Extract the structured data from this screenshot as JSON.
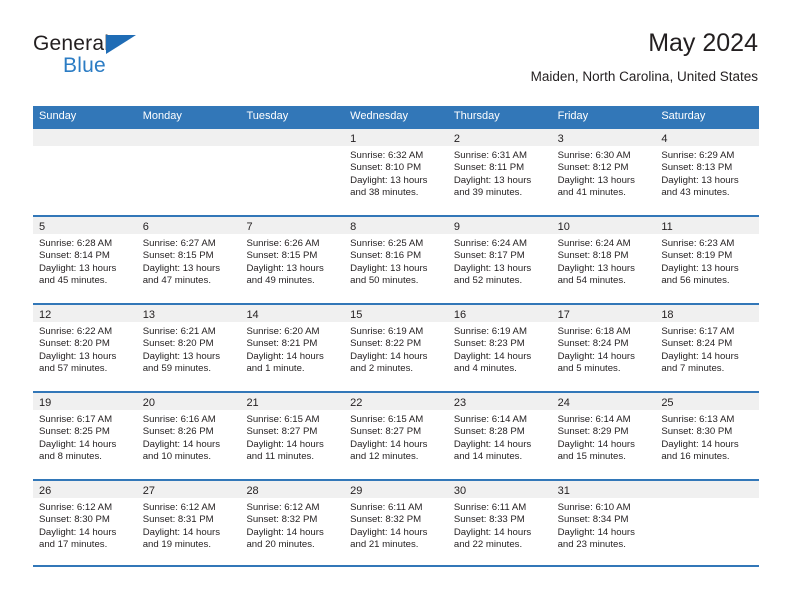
{
  "logo": {
    "word_one": "General",
    "word_two": "Blue",
    "triangle_color": "#1f6cb5",
    "blue_text_color": "#2b7cc4"
  },
  "header": {
    "title": "May 2024",
    "subtitle": "Maiden, North Carolina, United States"
  },
  "theme": {
    "header_blue": "#3277b8",
    "day_band_gray": "#f0f0f0",
    "text_color": "#231f20"
  },
  "weekdays": [
    "Sunday",
    "Monday",
    "Tuesday",
    "Wednesday",
    "Thursday",
    "Friday",
    "Saturday"
  ],
  "weeks": [
    [
      {
        "day": "",
        "lines": []
      },
      {
        "day": "",
        "lines": []
      },
      {
        "day": "",
        "lines": []
      },
      {
        "day": "1",
        "lines": [
          "Sunrise: 6:32 AM",
          "Sunset: 8:10 PM",
          "Daylight: 13 hours",
          "and 38 minutes."
        ]
      },
      {
        "day": "2",
        "lines": [
          "Sunrise: 6:31 AM",
          "Sunset: 8:11 PM",
          "Daylight: 13 hours",
          "and 39 minutes."
        ]
      },
      {
        "day": "3",
        "lines": [
          "Sunrise: 6:30 AM",
          "Sunset: 8:12 PM",
          "Daylight: 13 hours",
          "and 41 minutes."
        ]
      },
      {
        "day": "4",
        "lines": [
          "Sunrise: 6:29 AM",
          "Sunset: 8:13 PM",
          "Daylight: 13 hours",
          "and 43 minutes."
        ]
      }
    ],
    [
      {
        "day": "5",
        "lines": [
          "Sunrise: 6:28 AM",
          "Sunset: 8:14 PM",
          "Daylight: 13 hours",
          "and 45 minutes."
        ]
      },
      {
        "day": "6",
        "lines": [
          "Sunrise: 6:27 AM",
          "Sunset: 8:15 PM",
          "Daylight: 13 hours",
          "and 47 minutes."
        ]
      },
      {
        "day": "7",
        "lines": [
          "Sunrise: 6:26 AM",
          "Sunset: 8:15 PM",
          "Daylight: 13 hours",
          "and 49 minutes."
        ]
      },
      {
        "day": "8",
        "lines": [
          "Sunrise: 6:25 AM",
          "Sunset: 8:16 PM",
          "Daylight: 13 hours",
          "and 50 minutes."
        ]
      },
      {
        "day": "9",
        "lines": [
          "Sunrise: 6:24 AM",
          "Sunset: 8:17 PM",
          "Daylight: 13 hours",
          "and 52 minutes."
        ]
      },
      {
        "day": "10",
        "lines": [
          "Sunrise: 6:24 AM",
          "Sunset: 8:18 PM",
          "Daylight: 13 hours",
          "and 54 minutes."
        ]
      },
      {
        "day": "11",
        "lines": [
          "Sunrise: 6:23 AM",
          "Sunset: 8:19 PM",
          "Daylight: 13 hours",
          "and 56 minutes."
        ]
      }
    ],
    [
      {
        "day": "12",
        "lines": [
          "Sunrise: 6:22 AM",
          "Sunset: 8:20 PM",
          "Daylight: 13 hours",
          "and 57 minutes."
        ]
      },
      {
        "day": "13",
        "lines": [
          "Sunrise: 6:21 AM",
          "Sunset: 8:20 PM",
          "Daylight: 13 hours",
          "and 59 minutes."
        ]
      },
      {
        "day": "14",
        "lines": [
          "Sunrise: 6:20 AM",
          "Sunset: 8:21 PM",
          "Daylight: 14 hours",
          "and 1 minute."
        ]
      },
      {
        "day": "15",
        "lines": [
          "Sunrise: 6:19 AM",
          "Sunset: 8:22 PM",
          "Daylight: 14 hours",
          "and 2 minutes."
        ]
      },
      {
        "day": "16",
        "lines": [
          "Sunrise: 6:19 AM",
          "Sunset: 8:23 PM",
          "Daylight: 14 hours",
          "and 4 minutes."
        ]
      },
      {
        "day": "17",
        "lines": [
          "Sunrise: 6:18 AM",
          "Sunset: 8:24 PM",
          "Daylight: 14 hours",
          "and 5 minutes."
        ]
      },
      {
        "day": "18",
        "lines": [
          "Sunrise: 6:17 AM",
          "Sunset: 8:24 PM",
          "Daylight: 14 hours",
          "and 7 minutes."
        ]
      }
    ],
    [
      {
        "day": "19",
        "lines": [
          "Sunrise: 6:17 AM",
          "Sunset: 8:25 PM",
          "Daylight: 14 hours",
          "and 8 minutes."
        ]
      },
      {
        "day": "20",
        "lines": [
          "Sunrise: 6:16 AM",
          "Sunset: 8:26 PM",
          "Daylight: 14 hours",
          "and 10 minutes."
        ]
      },
      {
        "day": "21",
        "lines": [
          "Sunrise: 6:15 AM",
          "Sunset: 8:27 PM",
          "Daylight: 14 hours",
          "and 11 minutes."
        ]
      },
      {
        "day": "22",
        "lines": [
          "Sunrise: 6:15 AM",
          "Sunset: 8:27 PM",
          "Daylight: 14 hours",
          "and 12 minutes."
        ]
      },
      {
        "day": "23",
        "lines": [
          "Sunrise: 6:14 AM",
          "Sunset: 8:28 PM",
          "Daylight: 14 hours",
          "and 14 minutes."
        ]
      },
      {
        "day": "24",
        "lines": [
          "Sunrise: 6:14 AM",
          "Sunset: 8:29 PM",
          "Daylight: 14 hours",
          "and 15 minutes."
        ]
      },
      {
        "day": "25",
        "lines": [
          "Sunrise: 6:13 AM",
          "Sunset: 8:30 PM",
          "Daylight: 14 hours",
          "and 16 minutes."
        ]
      }
    ],
    [
      {
        "day": "26",
        "lines": [
          "Sunrise: 6:12 AM",
          "Sunset: 8:30 PM",
          "Daylight: 14 hours",
          "and 17 minutes."
        ]
      },
      {
        "day": "27",
        "lines": [
          "Sunrise: 6:12 AM",
          "Sunset: 8:31 PM",
          "Daylight: 14 hours",
          "and 19 minutes."
        ]
      },
      {
        "day": "28",
        "lines": [
          "Sunrise: 6:12 AM",
          "Sunset: 8:32 PM",
          "Daylight: 14 hours",
          "and 20 minutes."
        ]
      },
      {
        "day": "29",
        "lines": [
          "Sunrise: 6:11 AM",
          "Sunset: 8:32 PM",
          "Daylight: 14 hours",
          "and 21 minutes."
        ]
      },
      {
        "day": "30",
        "lines": [
          "Sunrise: 6:11 AM",
          "Sunset: 8:33 PM",
          "Daylight: 14 hours",
          "and 22 minutes."
        ]
      },
      {
        "day": "31",
        "lines": [
          "Sunrise: 6:10 AM",
          "Sunset: 8:34 PM",
          "Daylight: 14 hours",
          "and 23 minutes."
        ]
      },
      {
        "day": "",
        "lines": []
      }
    ]
  ]
}
